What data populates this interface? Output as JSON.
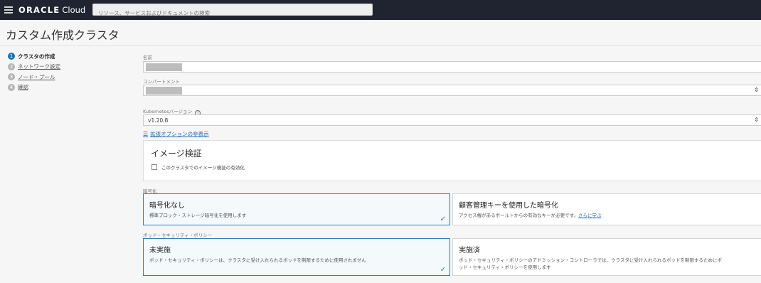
{
  "topbar": {
    "brand_bold": "ORACLE",
    "brand_light": "Cloud",
    "search_placeholder": "リソース、サービスおよびドキュメントの検索"
  },
  "page": {
    "title": "カスタム作成クラスタ"
  },
  "steps": [
    {
      "num": "1",
      "label": "クラスタの作成"
    },
    {
      "num": "2",
      "label": "ネットワーク設定"
    },
    {
      "num": "3",
      "label": "ノード・プール"
    },
    {
      "num": "4",
      "label": "確認"
    }
  ],
  "form": {
    "name_label": "名前",
    "compartment_label": "コンパートメント",
    "k8s_label": "Kubernetesバージョン",
    "k8s_value": "v1.20.8",
    "advanced_link": "拡張オプションの非表示",
    "image_panel_title": "イメージ検証",
    "image_checkbox_label": "このクラスタでのイメージ検証の有効化",
    "encryption_label": "暗号化",
    "policy_label": "ポッド・セキュリティ・ポリシー"
  },
  "encryption": [
    {
      "title": "暗号化なし",
      "desc": "標準ブロック・ストレージ暗号化を使用します",
      "selected": true
    },
    {
      "title": "顧客管理キーを使用した暗号化",
      "desc": "アクセス権があるボールトからの有効なキーが必要です。",
      "link": "さらに学ぶ",
      "selected": false
    }
  ],
  "policy": [
    {
      "title": "未実施",
      "desc": "ポッド・セキュリティ・ポリシーは、クラスタに受け入れられるポッドを制限するために使用されません",
      "selected": true
    },
    {
      "title": "実施済",
      "desc1": "ポッド・セキュリティ・ポリシーのアドミッション・コントローラでは、クラスタに受け入れられるポッドを制限するためにポ",
      "desc2": "ッド・セキュリティ・ポリシーを使用します",
      "selected": false
    }
  ]
}
